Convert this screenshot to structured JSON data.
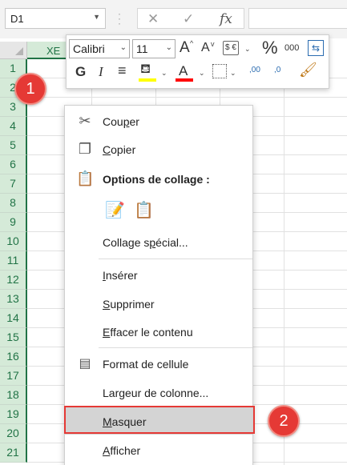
{
  "formula_bar": {
    "name_box_value": "D1",
    "cancel_icon": "✕",
    "enter_icon": "✓",
    "fx_icon": "fx",
    "formula_value": ""
  },
  "grid": {
    "visible_column_label": "XE",
    "rows": [
      "1",
      "2",
      "3",
      "4",
      "5",
      "6",
      "7",
      "8",
      "9",
      "10",
      "11",
      "12",
      "13",
      "14",
      "15",
      "16",
      "17",
      "18",
      "19",
      "20",
      "21"
    ]
  },
  "mini_toolbar": {
    "font_name": "Calibri",
    "font_size": "11",
    "grow_font": "A",
    "shrink_font": "A",
    "percent": "%",
    "thousands": "000",
    "bold": "G",
    "italic": "I",
    "font_color_letter": "A",
    "fill_color": "#ffff00",
    "font_color": "#ff0000",
    "decrease_decimals": ",0",
    "increase_decimals": ",00"
  },
  "context_menu": {
    "items": {
      "cut": {
        "pre": "Cou",
        "key": "p",
        "post": "er"
      },
      "copy": {
        "pre": "",
        "key": "C",
        "post": "opier"
      },
      "paste_options": "Options de collage :",
      "paste_special": {
        "pre": "Collage s",
        "key": "p",
        "post": "écial..."
      },
      "insert": {
        "pre": "",
        "key": "I",
        "post": "nsérer"
      },
      "delete": {
        "pre": "",
        "key": "S",
        "post": "upprimer"
      },
      "clear": {
        "pre": "",
        "key": "E",
        "post": "ffacer le contenu"
      },
      "format_cells": {
        "pre": "Format de cellule",
        "key": "",
        "post": ""
      },
      "column_width": {
        "pre": "Largeur de colonne...",
        "key": "",
        "post": ""
      },
      "hide": {
        "pre": "",
        "key": "M",
        "post": "asquer"
      },
      "unhide": {
        "pre": "",
        "key": "A",
        "post": "fficher"
      }
    }
  },
  "annotations": {
    "step1": "1",
    "step2": "2",
    "highlight_color": "#e53935"
  }
}
